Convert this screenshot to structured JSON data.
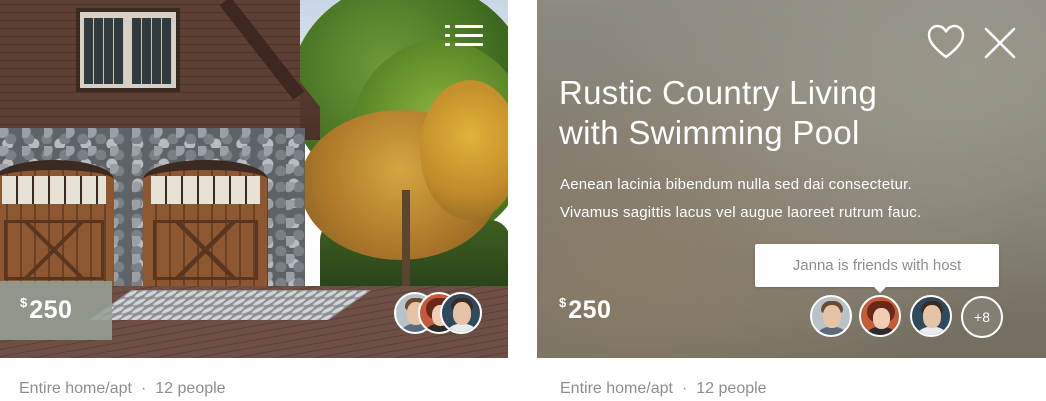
{
  "listings": [
    {
      "price": {
        "currency": "$",
        "amount": "250"
      },
      "menu_icon": "list-icon",
      "avatars": [
        "friend-avatar-man",
        "friend-avatar-woman",
        "friend-avatar-man-2"
      ],
      "caption": {
        "type": "Entire home/apt",
        "separator": "·",
        "capacity": "12 people"
      }
    },
    {
      "title_line_1": "Rustic Country Living",
      "title_line_2": "with Swimming Pool",
      "description_line_1": "Aenean lacinia bibendum nulla sed dai consectetur.",
      "description_line_2": "Vivamus sagittis lacus vel augue laoreet rutrum fauc.",
      "price": {
        "currency": "$",
        "amount": "250"
      },
      "tooltip": "Janna is friends with host",
      "more_count": "+8",
      "icons": [
        "heart-icon",
        "close-icon"
      ],
      "avatars": [
        "friend-avatar-man",
        "friend-avatar-woman",
        "friend-avatar-man-2"
      ],
      "caption": {
        "type": "Entire home/apt",
        "separator": "·",
        "capacity": "12 people"
      }
    }
  ],
  "colors": {
    "price_badge_bg": "#96a096",
    "caption_text": "#8a8f94",
    "tooltip_text": "#8a8f94",
    "overlay_bg": "#7e7a6e"
  }
}
